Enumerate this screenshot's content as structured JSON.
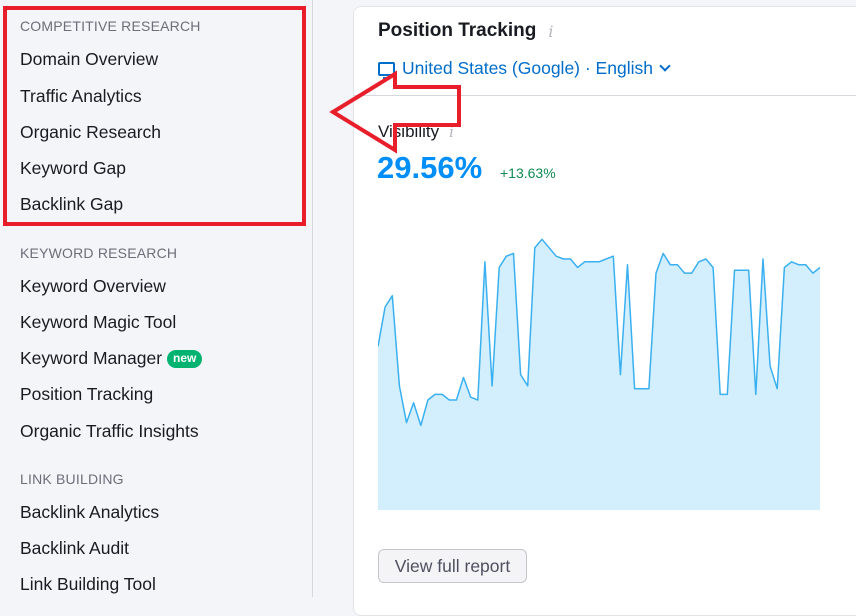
{
  "sidebar": {
    "sections": [
      {
        "title": "COMPETITIVE RESEARCH",
        "items": [
          {
            "label": "Domain Overview"
          },
          {
            "label": "Traffic Analytics"
          },
          {
            "label": "Organic Research"
          },
          {
            "label": "Keyword Gap"
          },
          {
            "label": "Backlink Gap"
          }
        ]
      },
      {
        "title": "KEYWORD RESEARCH",
        "items": [
          {
            "label": "Keyword Overview"
          },
          {
            "label": "Keyword Magic Tool"
          },
          {
            "label": "Keyword Manager",
            "badge": "new"
          },
          {
            "label": "Position Tracking"
          },
          {
            "label": "Organic Traffic Insights"
          }
        ]
      },
      {
        "title": "LINK BUILDING",
        "items": [
          {
            "label": "Backlink Analytics"
          },
          {
            "label": "Backlink Audit"
          },
          {
            "label": "Link Building Tool"
          }
        ]
      }
    ]
  },
  "widget": {
    "title": "Position Tracking",
    "info_icon": "i",
    "database": "United States (Google) · English",
    "device_icon": "desktop-monitor-icon",
    "visibility_label": "Visibility",
    "visibility_value": "29.56%",
    "visibility_delta": "+13.63%",
    "button_label": "View full report"
  },
  "colors": {
    "accent_blue": "#008ff8",
    "link_blue": "#006dca",
    "delta_green": "#108a52",
    "badge_green": "#00b371",
    "annotation_red": "#e81e2b",
    "chart_line": "#3ab0f0",
    "chart_fill": "#d3effd"
  },
  "chart_data": {
    "type": "area",
    "title": "Visibility",
    "xlabel": "",
    "ylabel": "",
    "ylim": [
      0,
      100
    ],
    "grid": false,
    "legend": "none",
    "values": [
      58,
      72,
      76,
      44,
      31,
      38,
      30,
      39,
      41,
      41,
      39,
      39,
      47,
      40,
      39,
      88,
      44,
      86,
      90,
      91,
      48,
      44,
      93,
      96,
      93,
      90,
      89,
      89,
      86,
      88,
      88,
      88,
      89,
      90,
      48,
      87,
      43,
      43,
      43,
      84,
      91,
      87,
      87,
      84,
      84,
      88,
      89,
      86,
      41,
      41,
      85,
      85,
      85,
      41,
      89,
      51,
      43,
      86,
      88,
      87,
      87,
      84,
      86
    ]
  }
}
